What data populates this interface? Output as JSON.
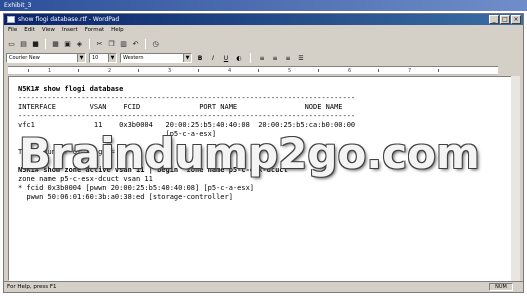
{
  "exhibit": {
    "title": "Exhibit_3"
  },
  "window": {
    "title": "show flogi database.rtf - WordPad",
    "buttons": {
      "minimize": "_",
      "maximize": "□",
      "close": "×"
    }
  },
  "menu": [
    "File",
    "Edit",
    "View",
    "Insert",
    "Format",
    "Help"
  ],
  "toolbar": {
    "icons": [
      "new-icon",
      "open-icon",
      "save-icon",
      "print-icon",
      "print-preview-icon",
      "find-icon",
      "cut-icon",
      "copy-icon",
      "paste-icon",
      "undo-icon",
      "datetime-icon"
    ]
  },
  "format": {
    "font": "Courier New",
    "size": "10",
    "script": "Western",
    "bold": "B",
    "italic": "I",
    "underline": "U"
  },
  "ruler": {
    "numbers": [
      "1",
      "2",
      "3",
      "4",
      "5",
      "6",
      "7"
    ]
  },
  "document": {
    "line1": "N5K1# show flogi database",
    "line2": "--------------------------------------------------------------------------------",
    "header": "INTERFACE        VSAN    FCID              PORT NAME                NODE NAME",
    "line4": "--------------------------------------------------------------------------------",
    "row1": "vfc1              11    0x3b0004   20:00:25:b5:40:40:08  20:00:25:b5:ca:b0:00:00",
    "row2": "                                   [p5-c-a-esx]",
    "total": "Total number of flogi = 1.",
    "cmd2": "N5K1# show zone active vsan 11 | begin 'zone name p5-c-esx-dcuct'",
    "zone1": "zone name p5-c-esx-dcuct vsan 11",
    "zone2": "* fcid 0x3b0004 [pwwn 20:00:25:b5:40:40:08] [p5-c-a-esx]",
    "zone3": "  pwwn 50:06:01:60:3b:a0:38:ed [storage-controller]"
  },
  "watermark": "Braindump2go.com",
  "status": {
    "help": "For Help, press F1",
    "num": "NUM"
  }
}
